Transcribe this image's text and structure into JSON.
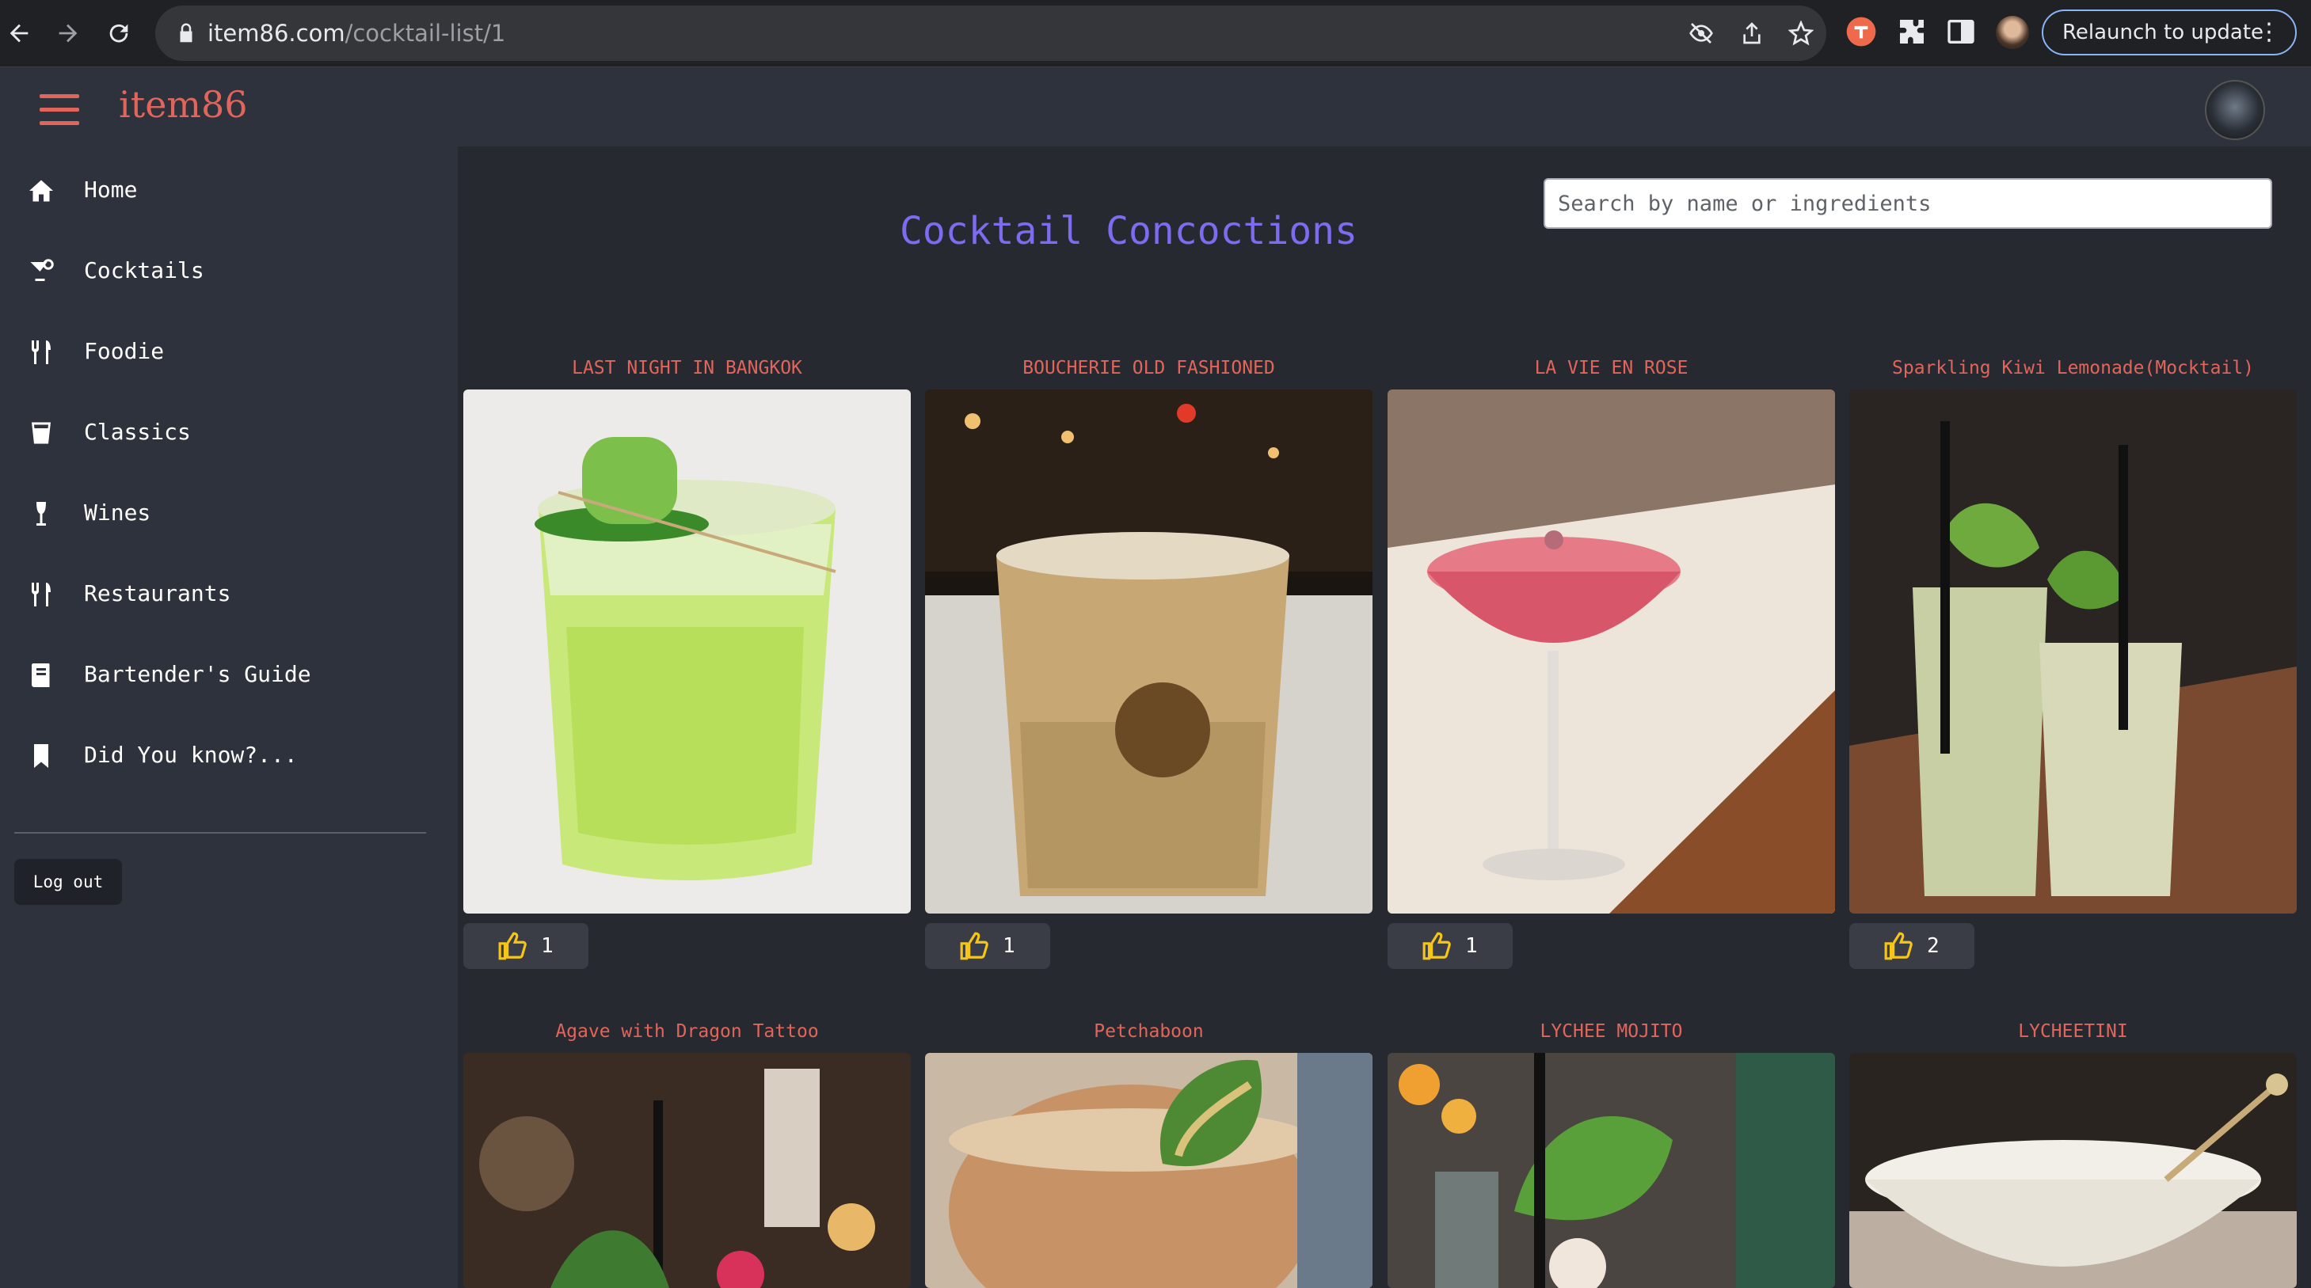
{
  "browser": {
    "url_host": "item86.com",
    "url_path": "/cocktail-list/1",
    "relaunch_label": "Relaunch to update"
  },
  "app": {
    "brand": "item86"
  },
  "sidebar": {
    "items": [
      {
        "label": "Home",
        "icon": "home-icon"
      },
      {
        "label": "Cocktails",
        "icon": "cocktail-icon"
      },
      {
        "label": "Foodie",
        "icon": "utensils-icon"
      },
      {
        "label": "Classics",
        "icon": "glass-icon"
      },
      {
        "label": "Wines",
        "icon": "wine-icon"
      },
      {
        "label": "Restaurants",
        "icon": "utensils-icon"
      },
      {
        "label": "Bartender's Guide",
        "icon": "book-icon"
      },
      {
        "label": "Did You know?...",
        "icon": "bookmark-icon"
      }
    ],
    "logout_label": "Log out"
  },
  "main": {
    "title": "Cocktail Concoctions",
    "search_placeholder": "Search by name or ingredients",
    "cards": [
      {
        "title": "LAST NIGHT IN BANGKOK",
        "likes": "1"
      },
      {
        "title": "BOUCHERIE OLD FASHIONED",
        "likes": "1"
      },
      {
        "title": "LA VIE EN ROSE",
        "likes": "1"
      },
      {
        "title": "Sparkling Kiwi Lemonade(Mocktail)",
        "likes": "2"
      },
      {
        "title": "Agave with Dragon Tattoo"
      },
      {
        "title": "Petchaboon"
      },
      {
        "title": "LYCHEE MOJITO"
      },
      {
        "title": "LYCHEETINI"
      }
    ]
  },
  "colors": {
    "accent": "#e2655b",
    "title": "#7b6cf0",
    "like_thumb": "#f5c518"
  }
}
